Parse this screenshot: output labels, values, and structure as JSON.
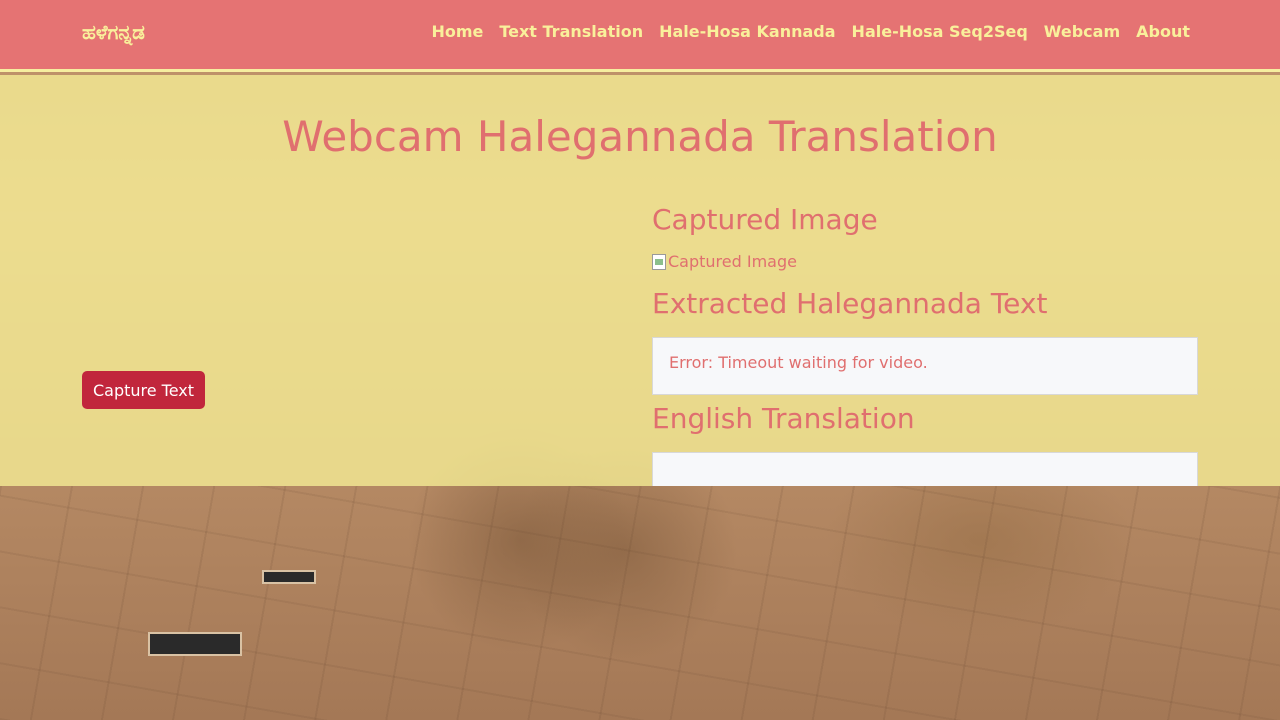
{
  "navbar": {
    "brand": "ಹಳೆಗನ್ನಡ",
    "links": [
      "Home",
      "Text Translation",
      "Hale-Hosa Kannada",
      "Hale-Hosa Seq2Seq",
      "Webcam",
      "About"
    ]
  },
  "main": {
    "title": "Webcam Halegannada Translation",
    "capture_button_label": "Capture Text",
    "captured_image_heading": "Captured Image",
    "captured_image_alt": "Captured Image",
    "extracted_heading": "Extracted Halegannada Text",
    "extracted_text": "Error: Timeout waiting for video.",
    "translation_heading": "English Translation",
    "translation_text": ""
  },
  "colors": {
    "navbar_bg": "#e57373",
    "nav_text": "#f9f09b",
    "accent_text": "#e06f6f",
    "button_bg": "#c1263c",
    "overlay": "#f6ee96"
  }
}
